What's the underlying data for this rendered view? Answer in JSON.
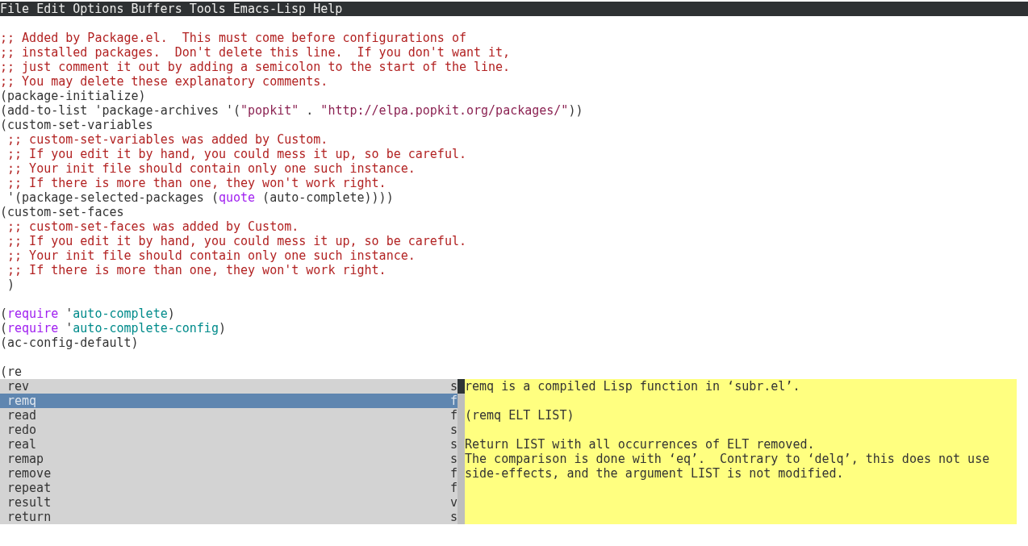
{
  "menu_bar": [
    "File",
    "Edit",
    "Options",
    "Buffers",
    "Tools",
    "Emacs-Lisp",
    "Help"
  ],
  "editor": {
    "lines": [
      {
        "kind": "blank"
      },
      {
        "kind": "code",
        "segments": [
          {
            "kind": "comment",
            "text": ";; Added by Package.el.  This must come before configurations of"
          }
        ]
      },
      {
        "kind": "code",
        "segments": [
          {
            "kind": "comment",
            "text": ";; installed packages.  Don't delete this line.  If you don't want it,"
          }
        ]
      },
      {
        "kind": "code",
        "segments": [
          {
            "kind": "comment",
            "text": ";; just comment it out by adding a semicolon to the start of the line."
          }
        ]
      },
      {
        "kind": "code",
        "segments": [
          {
            "kind": "comment",
            "text": ";; You may delete these explanatory comments."
          }
        ]
      },
      {
        "kind": "code",
        "segments": [
          {
            "kind": "plain",
            "text": "(package-initialize)"
          }
        ]
      },
      {
        "kind": "code",
        "segments": [
          {
            "kind": "plain",
            "text": "(add-to-list 'package-archives '("
          },
          {
            "kind": "string",
            "text": "\"popkit\""
          },
          {
            "kind": "plain",
            "text": " . "
          },
          {
            "kind": "string",
            "text": "\"http://elpa.popkit.org/packages/\""
          },
          {
            "kind": "plain",
            "text": "))"
          }
        ]
      },
      {
        "kind": "code",
        "segments": [
          {
            "kind": "plain",
            "text": "(custom-set-variables"
          }
        ]
      },
      {
        "kind": "code",
        "segments": [
          {
            "kind": "comment",
            "text": " ;; custom-set-variables was added by Custom."
          }
        ]
      },
      {
        "kind": "code",
        "segments": [
          {
            "kind": "comment",
            "text": " ;; If you edit it by hand, you could mess it up, so be careful."
          }
        ]
      },
      {
        "kind": "code",
        "segments": [
          {
            "kind": "comment",
            "text": " ;; Your init file should contain only one such instance."
          }
        ]
      },
      {
        "kind": "code",
        "segments": [
          {
            "kind": "comment",
            "text": " ;; If there is more than one, they won't work right."
          }
        ]
      },
      {
        "kind": "code",
        "segments": [
          {
            "kind": "plain",
            "text": " '(package-selected-packages ("
          },
          {
            "kind": "keyword",
            "text": "quote"
          },
          {
            "kind": "plain",
            "text": " (auto-complete))))"
          }
        ]
      },
      {
        "kind": "code",
        "segments": [
          {
            "kind": "plain",
            "text": "(custom-set-faces"
          }
        ]
      },
      {
        "kind": "code",
        "segments": [
          {
            "kind": "comment",
            "text": " ;; custom-set-faces was added by Custom."
          }
        ]
      },
      {
        "kind": "code",
        "segments": [
          {
            "kind": "comment",
            "text": " ;; If you edit it by hand, you could mess it up, so be careful."
          }
        ]
      },
      {
        "kind": "code",
        "segments": [
          {
            "kind": "comment",
            "text": " ;; Your init file should contain only one such instance."
          }
        ]
      },
      {
        "kind": "code",
        "segments": [
          {
            "kind": "comment",
            "text": " ;; If there is more than one, they won't work right."
          }
        ]
      },
      {
        "kind": "code",
        "segments": [
          {
            "kind": "plain",
            "text": " )"
          }
        ]
      },
      {
        "kind": "blank"
      },
      {
        "kind": "code",
        "segments": [
          {
            "kind": "plain",
            "text": "("
          },
          {
            "kind": "keyword",
            "text": "require"
          },
          {
            "kind": "plain",
            "text": " '"
          },
          {
            "kind": "constant",
            "text": "auto-complete"
          },
          {
            "kind": "plain",
            "text": ")"
          }
        ]
      },
      {
        "kind": "code",
        "segments": [
          {
            "kind": "plain",
            "text": "("
          },
          {
            "kind": "keyword",
            "text": "require"
          },
          {
            "kind": "plain",
            "text": " '"
          },
          {
            "kind": "constant",
            "text": "auto-complete-config"
          },
          {
            "kind": "plain",
            "text": ")"
          }
        ]
      },
      {
        "kind": "code",
        "segments": [
          {
            "kind": "plain",
            "text": "(ac-config-default)"
          }
        ]
      },
      {
        "kind": "blank"
      },
      {
        "kind": "code",
        "segments": [
          {
            "kind": "plain",
            "text": "(re"
          }
        ]
      }
    ]
  },
  "completion": {
    "candidates": [
      {
        "label": "rev",
        "type": "s",
        "selected": false
      },
      {
        "label": "remq",
        "type": "f",
        "selected": true
      },
      {
        "label": "read",
        "type": "f",
        "selected": false
      },
      {
        "label": "redo",
        "type": "s",
        "selected": false
      },
      {
        "label": "real",
        "type": "s",
        "selected": false
      },
      {
        "label": "remap",
        "type": "s",
        "selected": false
      },
      {
        "label": "remove",
        "type": "f",
        "selected": false
      },
      {
        "label": "repeat",
        "type": "f",
        "selected": false
      },
      {
        "label": "result",
        "type": "v",
        "selected": false
      },
      {
        "label": "return",
        "type": "s",
        "selected": false
      }
    ],
    "doc": [
      [
        "remq is a compiled Lisp function in ‘subr.el’."
      ],
      [
        "(remq ELT LIST)"
      ],
      [
        "Return LIST with all occurrences of ELT removed.",
        "The comparison is done with ‘eq’.  Contrary to ‘delq’, this does not use",
        "side-effects, and the argument LIST is not modified."
      ]
    ]
  }
}
